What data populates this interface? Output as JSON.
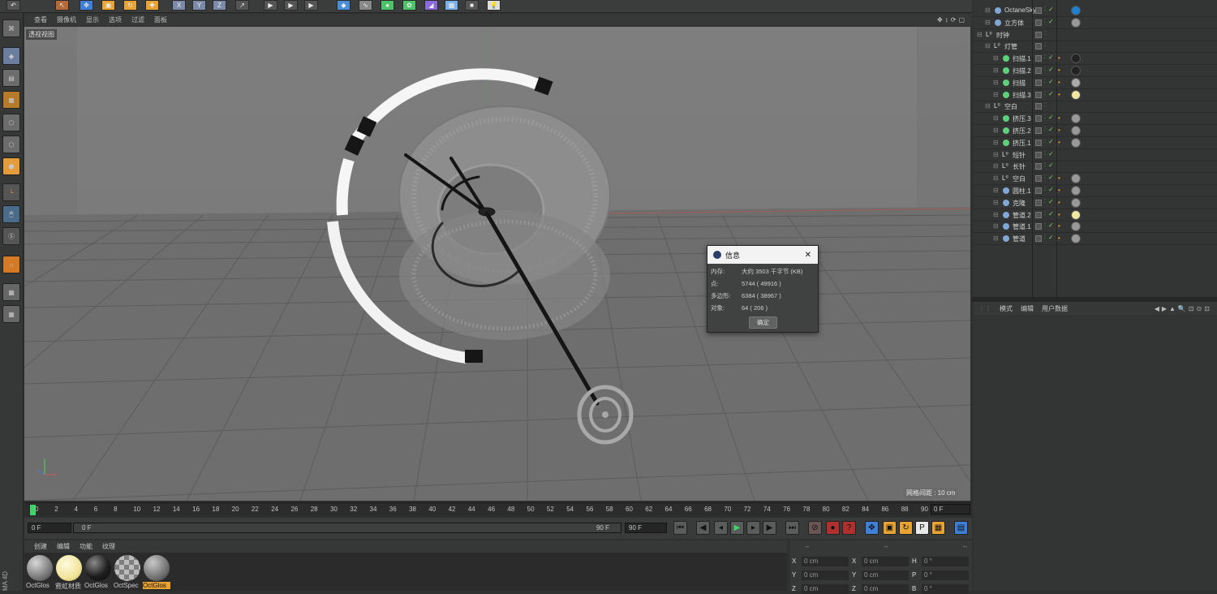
{
  "viewport": {
    "menu": [
      "查看",
      "摄像机",
      "显示",
      "选项",
      "过滤",
      "面板"
    ],
    "view_name": "透视视图",
    "grid_spacing": "网格间距 : 10 cm"
  },
  "dialog": {
    "title": "信息",
    "rows": [
      {
        "key": "内存:",
        "value": "大约 3503 千字节 (KB)"
      },
      {
        "key": "点:",
        "value": "5744 ( 49916 )"
      },
      {
        "key": "多边形:",
        "value": "6384 ( 38967 )"
      },
      {
        "key": "对象:",
        "value": "64 ( 206 )"
      }
    ],
    "ok_label": "确定",
    "close_glyph": "✕"
  },
  "timeline": {
    "ticks": [
      "0",
      "2",
      "4",
      "6",
      "8",
      "10",
      "12",
      "14",
      "16",
      "18",
      "20",
      "22",
      "24",
      "26",
      "28",
      "30",
      "32",
      "34",
      "36",
      "38",
      "40",
      "42",
      "44",
      "46",
      "48",
      "50",
      "52",
      "54",
      "56",
      "58",
      "60",
      "62",
      "64",
      "66",
      "68",
      "70",
      "72",
      "74",
      "76",
      "78",
      "80",
      "82",
      "84",
      "86",
      "88",
      "90"
    ],
    "current_frame": "0 F",
    "start": "0 F",
    "range_start": "0 F",
    "range_end": "90 F",
    "end": "90 F"
  },
  "materials": {
    "menu": [
      "创建",
      "编辑",
      "功能",
      "纹理"
    ],
    "items": [
      {
        "label": "OctGlos",
        "color": "#8a8a8a"
      },
      {
        "label": "霓虹材质",
        "color": "#f4e9a0"
      },
      {
        "label": "OctGlos",
        "color": "#1c1c1c"
      },
      {
        "label": "OctSpec",
        "color": "#b5b5b5"
      },
      {
        "label": "OctGlos",
        "color": "#7a7a7a",
        "selected": true
      }
    ],
    "side_label": "MA 4D"
  },
  "coords": {
    "header": [
      "--",
      "--",
      "--"
    ],
    "rows": [
      [
        {
          "l": "X",
          "v": "0 cm"
        },
        {
          "l": "X",
          "v": "0 cm"
        },
        {
          "l": "H",
          "v": "0 °"
        }
      ],
      [
        {
          "l": "Y",
          "v": "0 cm"
        },
        {
          "l": "Y",
          "v": "0 cm"
        },
        {
          "l": "P",
          "v": "0 °"
        }
      ],
      [
        {
          "l": "Z",
          "v": "0 cm"
        },
        {
          "l": "Z",
          "v": "0 cm"
        },
        {
          "l": "B",
          "v": "0 °"
        }
      ]
    ]
  },
  "objects": [
    {
      "name": "OctaneSky",
      "indent": 1,
      "icon": "#7fa7d6",
      "tag": "#1f7fd1"
    },
    {
      "name": "立方体",
      "indent": 1,
      "icon": "#7fa7d6",
      "tag": "#999"
    },
    {
      "name": "时钟",
      "indent": 0,
      "icon": "null",
      "tag": ""
    },
    {
      "name": "灯管",
      "indent": 1,
      "icon": "null",
      "tag": ""
    },
    {
      "name": "扫描.1",
      "indent": 2,
      "icon": "#5fd07a",
      "tag": "#222"
    },
    {
      "name": "扫描.2",
      "indent": 2,
      "icon": "#5fd07a",
      "tag": "#222"
    },
    {
      "name": "扫描",
      "indent": 2,
      "icon": "#5fd07a",
      "tag": "#aaa"
    },
    {
      "name": "扫描.3",
      "indent": 2,
      "icon": "#5fd07a",
      "tag": "#f3e8a2"
    },
    {
      "name": "空白",
      "indent": 1,
      "icon": "null",
      "tag": ""
    },
    {
      "name": "挤压.3",
      "indent": 2,
      "icon": "#5fd07a",
      "tag": "#999"
    },
    {
      "name": "挤压.2",
      "indent": 2,
      "icon": "#5fd07a",
      "tag": "#999"
    },
    {
      "name": "挤压.1",
      "indent": 2,
      "icon": "#5fd07a",
      "tag": "#999"
    },
    {
      "name": "短针",
      "indent": 2,
      "icon": "null",
      "tag": ""
    },
    {
      "name": "长针",
      "indent": 2,
      "icon": "null",
      "tag": ""
    },
    {
      "name": "空白",
      "indent": 2,
      "icon": "null",
      "tag": "#999"
    },
    {
      "name": "圆柱.1",
      "indent": 2,
      "icon": "#7fa7d6",
      "tag": "#999"
    },
    {
      "name": "克隆",
      "indent": 2,
      "icon": "#7fa7d6",
      "tag": "#999"
    },
    {
      "name": "管道.2",
      "indent": 2,
      "icon": "#7fa7d6",
      "tag": "#f3e8a2"
    },
    {
      "name": "管道.1",
      "indent": 2,
      "icon": "#7fa7d6",
      "tag": "#999"
    },
    {
      "name": "管道",
      "indent": 2,
      "icon": "#7fa7d6",
      "tag": "#999"
    }
  ],
  "attributes": {
    "menu": [
      "模式",
      "编辑",
      "用户数据"
    ]
  }
}
